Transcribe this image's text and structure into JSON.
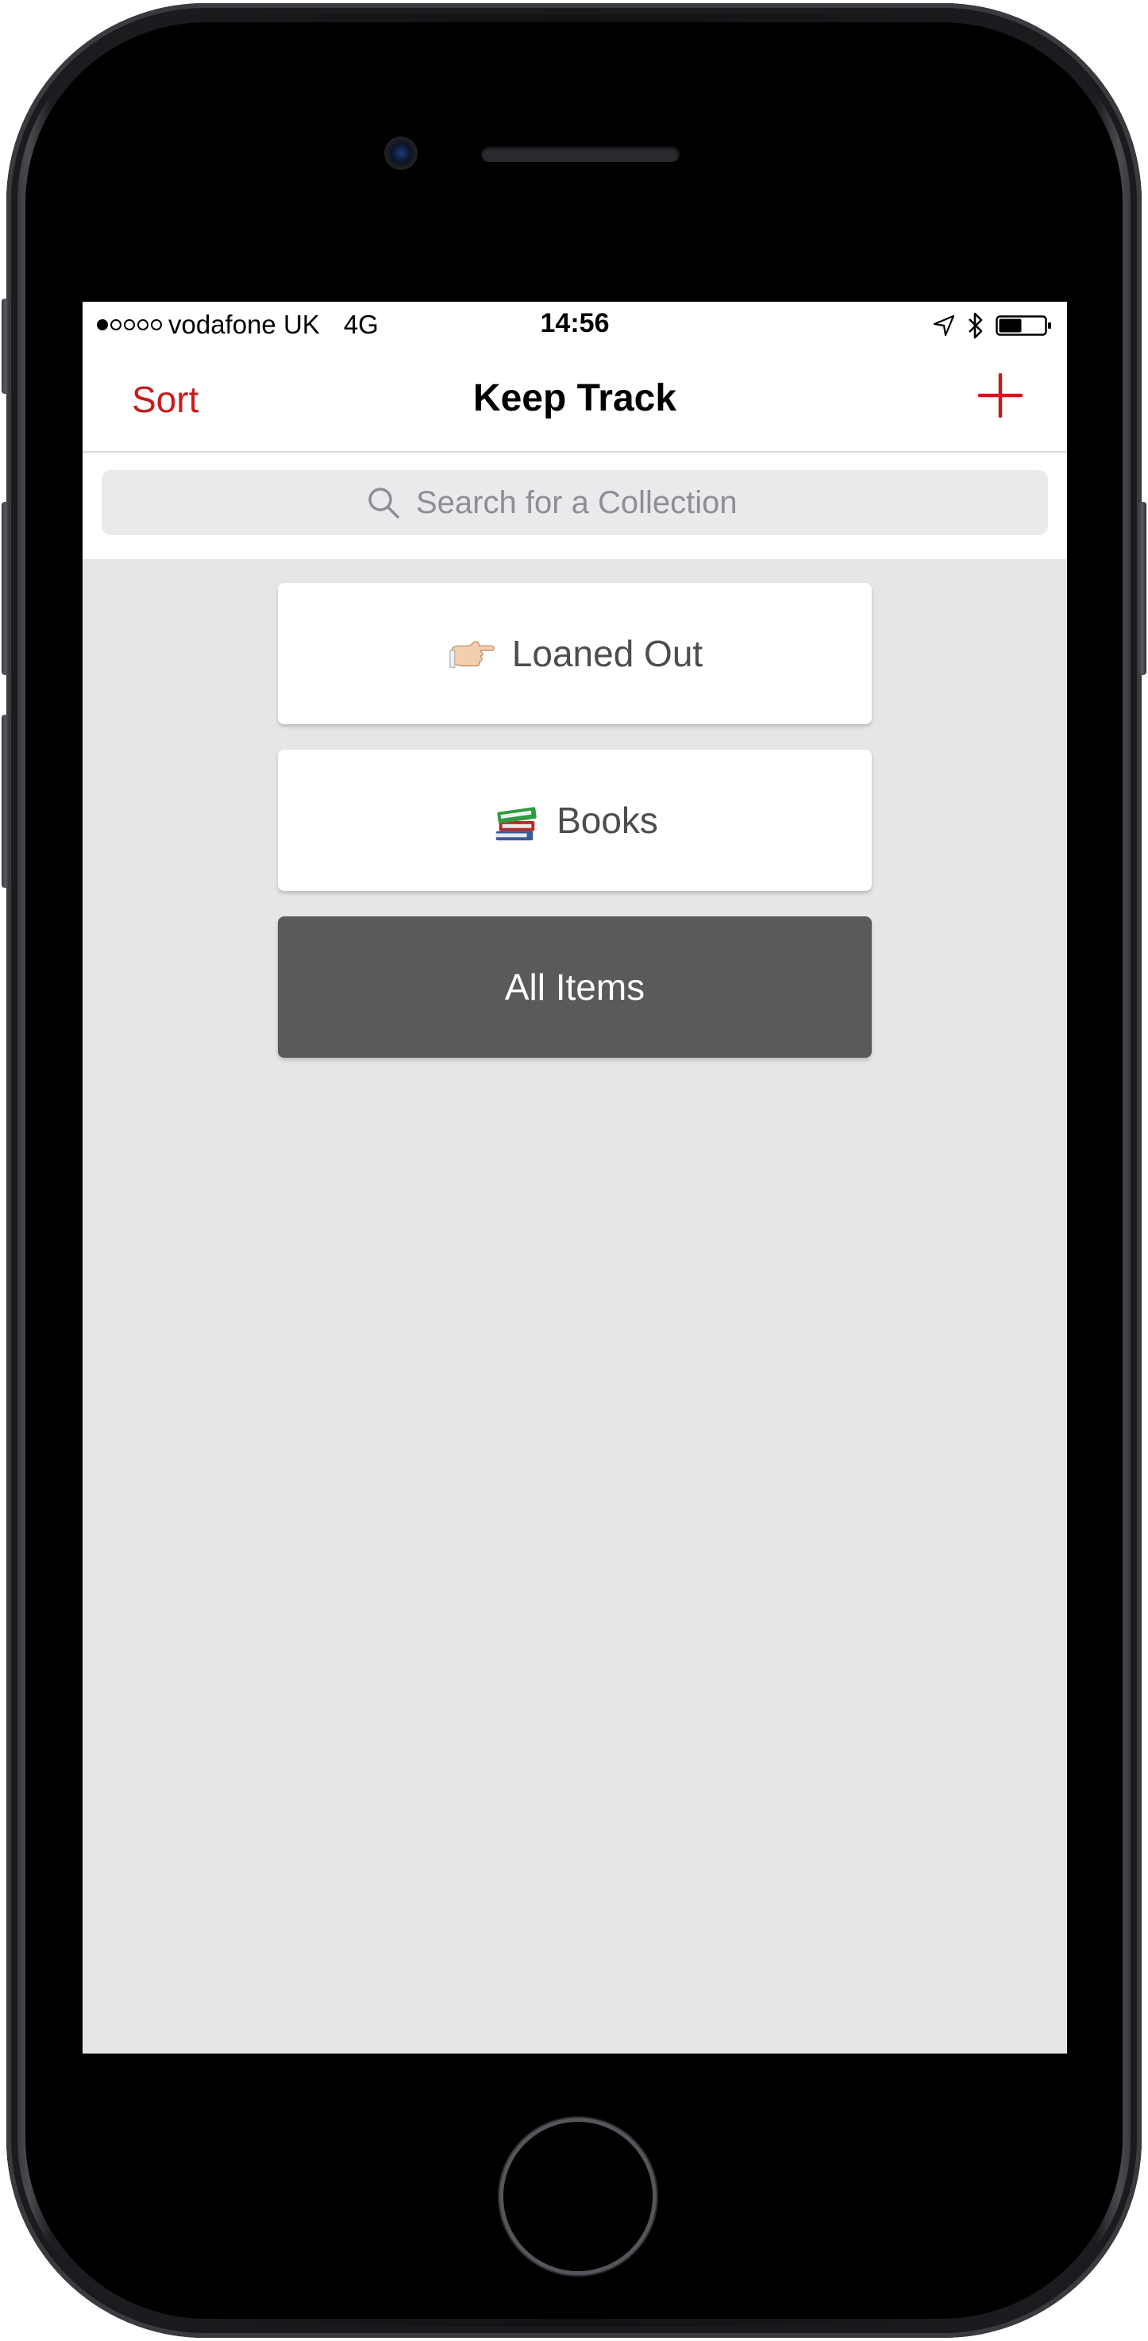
{
  "status_bar": {
    "carrier": "vodafone UK",
    "network": "4G",
    "time": "14:56",
    "signal_bars_filled": 1,
    "signal_bars_total": 5,
    "battery_level": 0.5
  },
  "nav": {
    "left_label": "Sort",
    "title": "Keep Track",
    "right_icon": "plus-icon"
  },
  "search": {
    "placeholder": "Search for a Collection",
    "value": ""
  },
  "collections": [
    {
      "label": "Loaned Out",
      "icon": "pointing-hand-icon"
    },
    {
      "label": "Books",
      "icon": "books-icon"
    },
    {
      "label": "All Items",
      "icon": ""
    }
  ],
  "colors": {
    "accent": "#c91c1c",
    "background": "#e5e6e6",
    "card": "#ffffff",
    "card_dark": "#5a5a5a"
  }
}
